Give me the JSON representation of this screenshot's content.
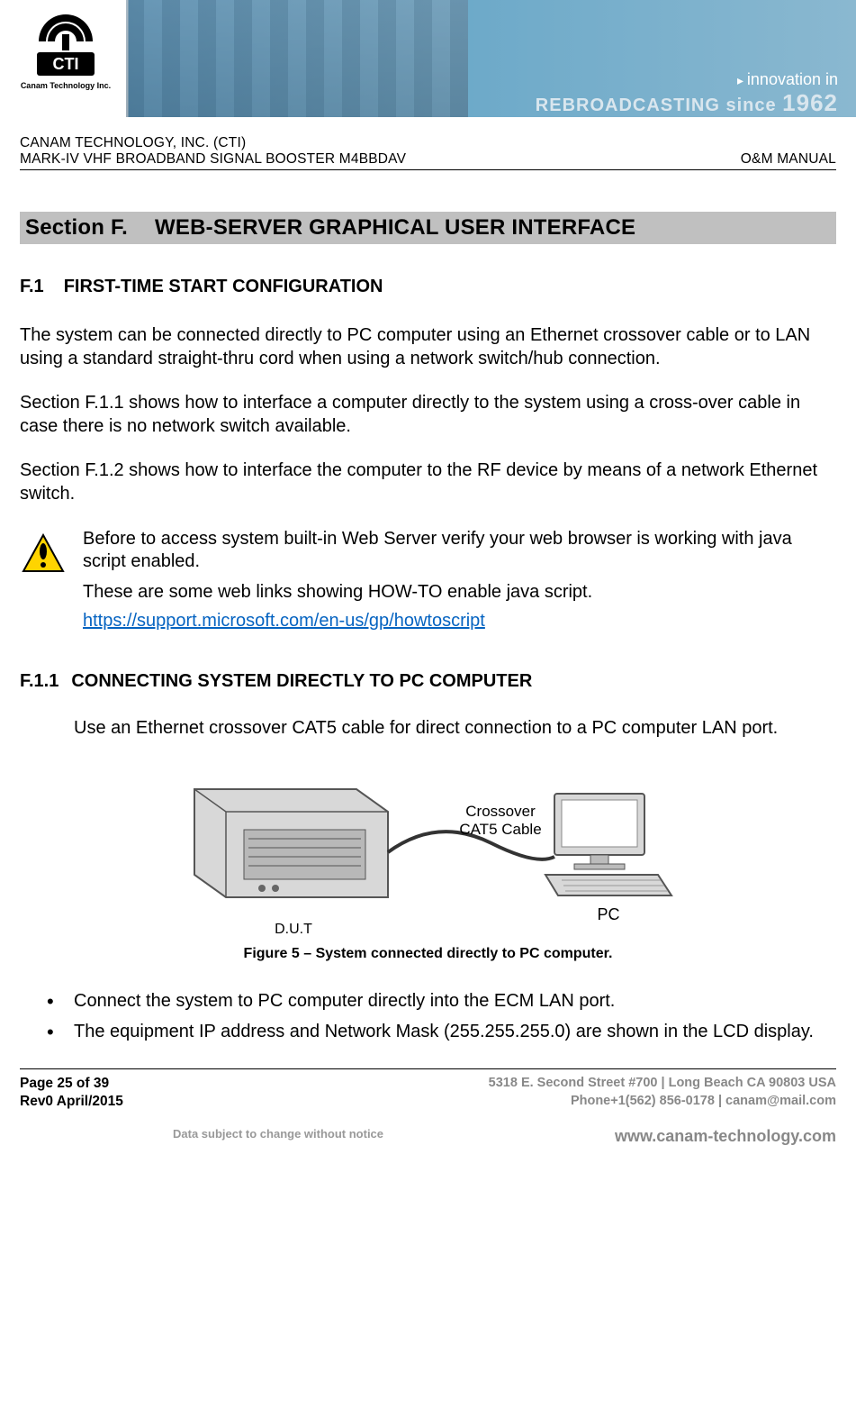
{
  "banner": {
    "logo_company": "Canam Technology Inc.",
    "tagline_line1": "innovation in",
    "tagline_line2_prefix": "REBROADCASTING since ",
    "tagline_year": "1962"
  },
  "header": {
    "company": "CANAM TECHNOLOGY, INC. (CTI)",
    "product": "MARK-IV VHF BROADBAND SIGNAL BOOSTER M4BBDAV",
    "doc_type": "O&M MANUAL"
  },
  "section": {
    "label": "Section F.",
    "title": "WEB-SERVER GRAPHICAL USER INTERFACE"
  },
  "f1": {
    "num": "F.1",
    "title": "FIRST-TIME START CONFIGURATION",
    "p1": "The system can be connected directly to PC computer using an Ethernet crossover cable or to LAN using a standard straight-thru cord when using a network switch/hub connection.",
    "p2": "Section F.1.1 shows how to interface a computer directly to the system using a cross-over cable in case there is no network switch available.",
    "p3": "Section F.1.2 shows how to interface the computer to the RF device by means of a network Ethernet switch."
  },
  "note": {
    "p1": "Before to access system built-in Web Server verify your web browser is working with java script enabled.",
    "p2": "These are some web links showing HOW-TO enable java script.",
    "link": "https://support.microsoft.com/en-us/gp/howtoscript"
  },
  "f11": {
    "num": "F.1.1",
    "title": "CONNECTING SYSTEM DIRECTLY TO PC COMPUTER",
    "p1": "Use an Ethernet crossover CAT5 cable for direct connection to a PC computer LAN port.",
    "figure_caption": "Figure 5 – System connected directly to PC computer.",
    "fig_dut": "D.U.T",
    "fig_cable": "Crossover\nCAT5 Cable",
    "fig_pc": "PC",
    "bullets": [
      "Connect the system to PC computer directly into the ECM LAN port.",
      "The equipment IP address and Network Mask (255.255.255.0) are shown in the LCD display."
    ]
  },
  "footer": {
    "page": "Page 25 of 39",
    "rev": "Rev0 April/2015",
    "address": "5318 E. Second Street  #700 | Long Beach CA 90803 USA",
    "phone": "Phone+1(562) 856-0178 | canam@mail.com",
    "notice": "Data subject to change without notice",
    "url": "www.canam-technology.com"
  }
}
